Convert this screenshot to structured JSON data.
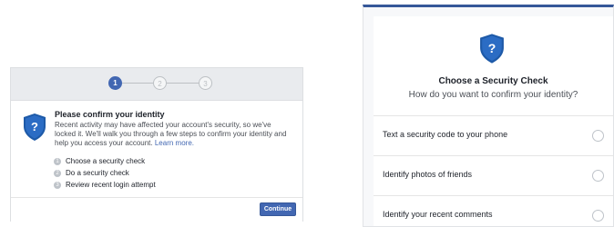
{
  "left_panel": {
    "steps": [
      "1",
      "2",
      "3"
    ],
    "title": "Please confirm your identity",
    "body": "Recent activity may have affected your account's security, so we've locked it. We'll walk you through a few steps to confirm your identity and help you access your account.",
    "learn_more": "Learn more.",
    "checklist": [
      {
        "num": "1",
        "label": "Choose a security check"
      },
      {
        "num": "2",
        "label": "Do a security check"
      },
      {
        "num": "3",
        "label": "Review recent login attempt"
      }
    ],
    "continue_label": "Continue",
    "icon": "shield-question-icon",
    "colors": {
      "primary": "#4267b2",
      "shield": "#1e5aa8"
    }
  },
  "right_panel": {
    "title": "Choose a Security Check",
    "subtitle": "How do you want to confirm your identity?",
    "options": [
      {
        "label": "Text a security code to your phone"
      },
      {
        "label": "Identify photos of friends"
      },
      {
        "label": "Identify your recent comments"
      }
    ],
    "icon": "shield-question-icon"
  }
}
